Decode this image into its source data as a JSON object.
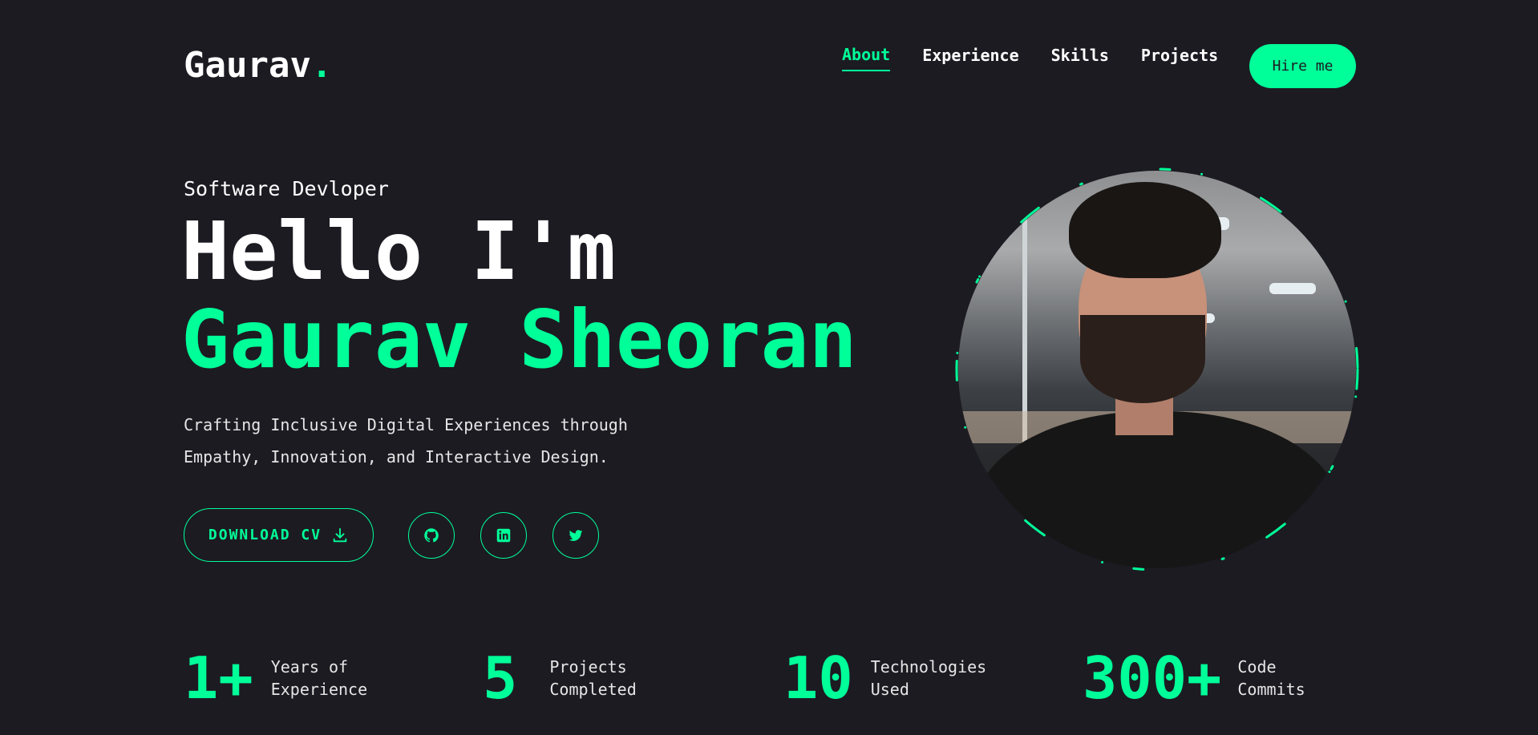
{
  "brand": {
    "name": "Gaurav",
    "dot": "."
  },
  "nav": {
    "items": [
      {
        "label": "About",
        "active": true
      },
      {
        "label": "Experience",
        "active": false
      },
      {
        "label": "Skills",
        "active": false
      },
      {
        "label": "Projects",
        "active": false
      }
    ],
    "hire_label": "Hire me"
  },
  "hero": {
    "role": "Software Devloper",
    "greeting": "Hello I'm",
    "name": "Gaurav Sheoran",
    "tagline": "Crafting Inclusive Digital Experiences through Empathy, Innovation, and Interactive Design.",
    "download_label": "DOWNLOAD CV",
    "socials": [
      {
        "icon": "github-icon"
      },
      {
        "icon": "linkedin-icon"
      },
      {
        "icon": "twitter-icon"
      }
    ]
  },
  "stats": [
    {
      "value": "1+",
      "label": "Years of Experience"
    },
    {
      "value": "5",
      "label": "Projects Completed"
    },
    {
      "value": "10",
      "label": "Technologies Used"
    },
    {
      "value": "300+",
      "label": "Code Commits"
    }
  ],
  "colors": {
    "background": "#1c1b22",
    "accent": "#00ff99",
    "text": "#ffffff"
  }
}
